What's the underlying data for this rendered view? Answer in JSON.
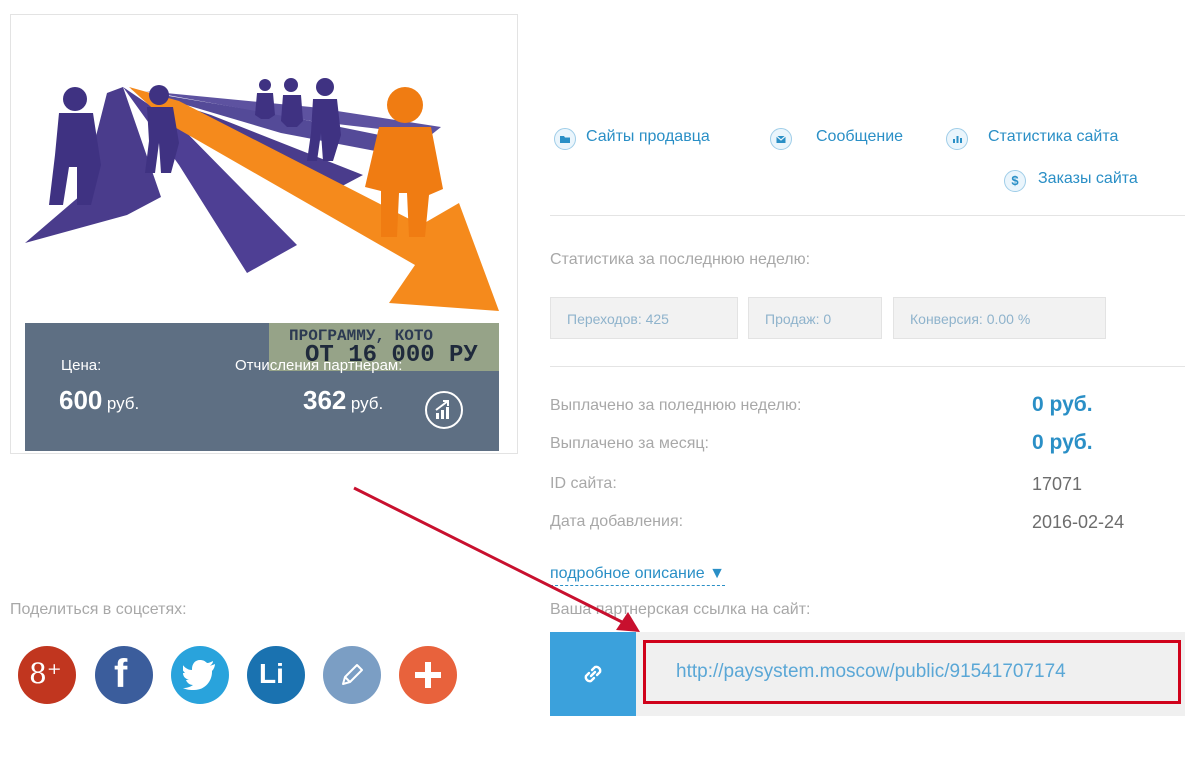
{
  "card": {
    "ad_line1": "ПРОГРАММУ, КОТО",
    "ad_line2": "ОТ 16 000 РУ",
    "price_label": "Цена:",
    "price_value": "600",
    "price_currency": "руб.",
    "partner_label": "Отчисления партнерам:",
    "partner_value": "362",
    "partner_currency": "руб."
  },
  "actions": {
    "seller_sites": "Сайты продавца",
    "message": "Сообщение",
    "site_stats": "Статистика сайта",
    "site_orders": "Заказы сайта"
  },
  "weekly_stats": {
    "title": "Статистика за последнюю неделю:",
    "clicks": "Переходов: 425",
    "sales": "Продаж: 0",
    "conversion": "Конверсия: 0.00 %"
  },
  "details": [
    {
      "label": "Выплачено за поледнюю неделю:",
      "value": "0 руб."
    },
    {
      "label": "Выплачено за месяц:",
      "value": "0 руб."
    },
    {
      "label": "ID сайта:",
      "value": "17071"
    },
    {
      "label": "Дата добавления:",
      "value": "2016-02-24"
    }
  ],
  "more_description": "подробное описание ▼",
  "partner_link": {
    "label": "Ваша партнерская ссылка на сайт:",
    "url": "http://paysystem.moscow/public/91541707174"
  },
  "share": {
    "label": "Поделиться в соцсетях:",
    "gplus_text": "8⁺",
    "facebook_text": "f",
    "linkedin_text": "Li"
  },
  "colors": {
    "accent": "#3ba1dc",
    "highlight": "#d0021b",
    "google_plus": "#c1361f",
    "facebook": "#3b5d9c",
    "twitter": "#29a3dc",
    "linkedin": "#1a72b0",
    "edit": "#7b9ec4",
    "plus": "#e8623c"
  }
}
